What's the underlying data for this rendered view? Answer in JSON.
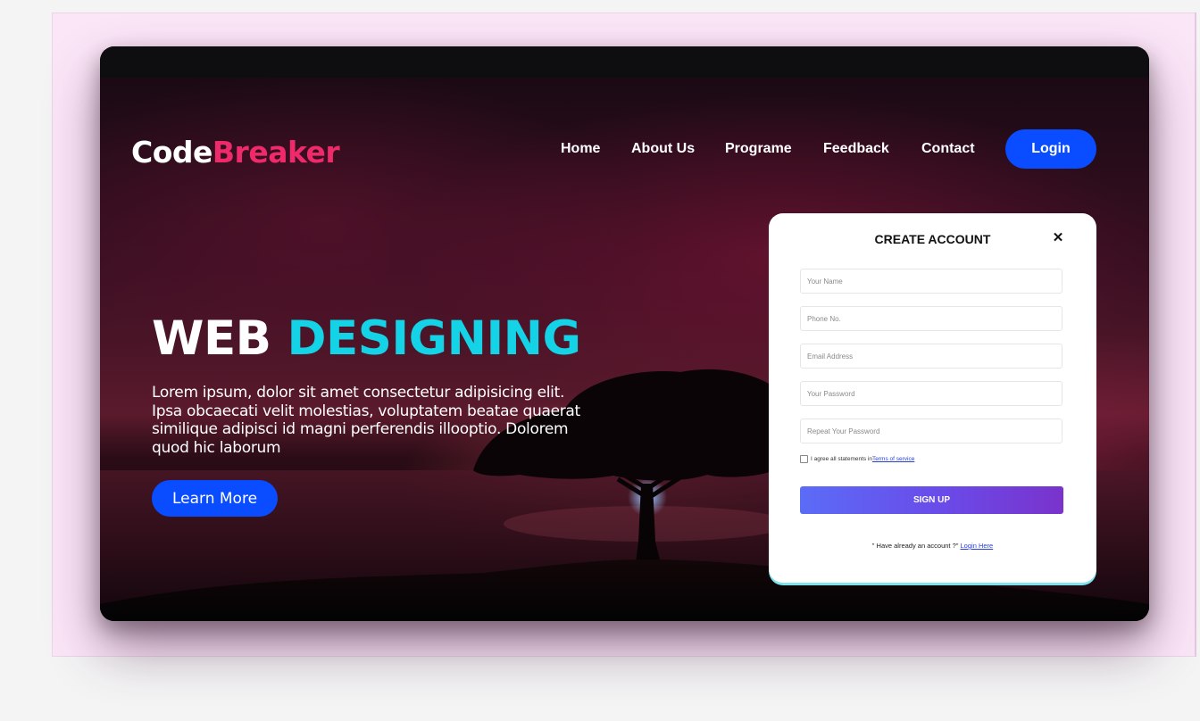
{
  "brand": {
    "logo_part1": "Code",
    "logo_part2": "Breaker"
  },
  "nav": {
    "items": [
      "Home",
      "About Us",
      "Programe",
      "Feedback",
      "Contact"
    ],
    "login_label": "Login"
  },
  "hero": {
    "headline_part1": "WEB",
    "headline_part2": "DESIGNING",
    "body": "Lorem ipsum, dolor sit amet consectetur adipisicing elit. Ipsa obcaecati velit molestias, voluptatem beatae quaerat similique adipisci id magni perferendis illooptio. Dolorem quod hic laborum",
    "cta_label": "Learn More"
  },
  "signup_card": {
    "title": "CREATE ACCOUNT",
    "close_glyph": "✕",
    "fields": [
      {
        "placeholder": "Your Name"
      },
      {
        "placeholder": "Phone No."
      },
      {
        "placeholder": "Email Address"
      },
      {
        "placeholder": "Your Password"
      },
      {
        "placeholder": "Repeat Your Password"
      }
    ],
    "agree_text": "I agree all statements in",
    "terms_link": "Terms of service",
    "submit_label": "SIGN UP",
    "have_account_text": "\" Have already an account ?\"",
    "login_link": "Login Here"
  },
  "colors": {
    "brand_accent": "#ee2a6b",
    "headline_accent": "#14d3e6",
    "primary_button": "#0a4cff",
    "signup_gradient_start": "#5b6cf7",
    "signup_gradient_end": "#7a33cc",
    "page_background": "#fbe6f8"
  }
}
